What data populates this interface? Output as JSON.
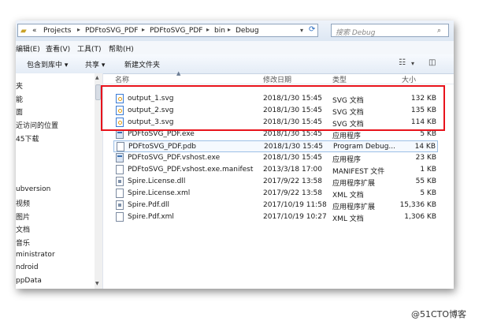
{
  "address": {
    "prefix": "«",
    "crumbs": [
      "Projects",
      "PDFtoSVG_PDF",
      "PDFtoSVG_PDF",
      "bin",
      "Debug"
    ],
    "search_placeholder": "搜索 Debug"
  },
  "menu": [
    "编辑(E)",
    "查看(V)",
    "工具(T)",
    "帮助(H)"
  ],
  "toolbar": {
    "include_library": "包含到库中 ▾",
    "share": "共享 ▾",
    "new_folder": "新建文件夹"
  },
  "nav": [
    "夹",
    "能",
    "面",
    "近访问的位置",
    "45下载",
    "ubversion",
    "视频",
    "图片",
    "文档",
    "音乐",
    "ministrator",
    "ndroid",
    "ppData"
  ],
  "columns": {
    "name": "名称",
    "date": "修改日期",
    "type": "类型",
    "size": "大小"
  },
  "files": [
    {
      "name": "output_1.svg",
      "date": "2018/1/30 15:45",
      "type": "SVG 文档",
      "size": "132 KB",
      "icon": "svg"
    },
    {
      "name": "output_2.svg",
      "date": "2018/1/30 15:45",
      "type": "SVG 文档",
      "size": "135 KB",
      "icon": "svg"
    },
    {
      "name": "output_3.svg",
      "date": "2018/1/30 15:45",
      "type": "SVG 文档",
      "size": "114 KB",
      "icon": "svg"
    },
    {
      "name": "PDFtoSVG_PDF.exe",
      "date": "2018/1/30 15:45",
      "type": "应用程序",
      "size": "5 KB",
      "icon": "exe"
    },
    {
      "name": "PDFtoSVG_PDF.pdb",
      "date": "2018/1/30 15:45",
      "type": "Program Debug...",
      "size": "14 KB",
      "icon": "pdb"
    },
    {
      "name": "PDFtoSVG_PDF.vshost.exe",
      "date": "2018/1/30 15:45",
      "type": "应用程序",
      "size": "23 KB",
      "icon": "exe"
    },
    {
      "name": "PDFtoSVG_PDF.vshost.exe.manifest",
      "date": "2013/3/18 17:00",
      "type": "MANIFEST 文件",
      "size": "1 KB",
      "icon": "file"
    },
    {
      "name": "Spire.License.dll",
      "date": "2017/9/22 13:58",
      "type": "应用程序扩展",
      "size": "55 KB",
      "icon": "dll"
    },
    {
      "name": "Spire.License.xml",
      "date": "2017/9/22 13:58",
      "type": "XML 文档",
      "size": "5 KB",
      "icon": "file"
    },
    {
      "name": "Spire.Pdf.dll",
      "date": "2017/10/19 11:58",
      "type": "应用程序扩展",
      "size": "15,336 KB",
      "icon": "dll"
    },
    {
      "name": "Spire.Pdf.xml",
      "date": "2017/10/19 10:27",
      "type": "XML 文档",
      "size": "1,306 KB",
      "icon": "file"
    }
  ],
  "watermark": "@51CTO博客"
}
